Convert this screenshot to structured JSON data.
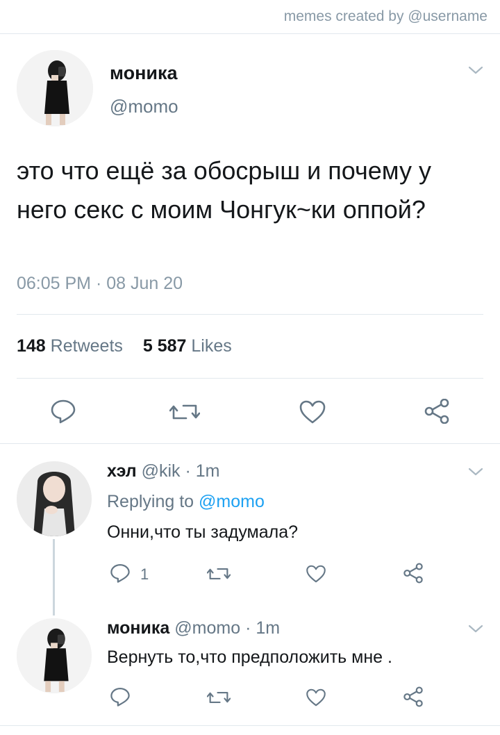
{
  "watermark": "memes created by @username",
  "main_tweet": {
    "name": "моника",
    "handle": "@momo",
    "text": "это что ещё за обосрыш и почему у него секс с моим Чонгук~ки оппой?",
    "timestamp": "06:05 PM · 08 Jun 20",
    "retweets_count": "148",
    "retweets_label": "Retweets",
    "likes_count": "5 587",
    "likes_label": "Likes",
    "icons": [
      "reply-icon",
      "retweet-icon",
      "like-icon",
      "share-icon",
      "chevron-down-icon"
    ]
  },
  "replies": [
    {
      "name": "хэл",
      "handle": "@kik",
      "time": "· 1m",
      "replying_prefix": "Replying to",
      "replying_to": "@momo",
      "text": "Онни,что ты задумала?",
      "reply_count": "1"
    },
    {
      "name": "моника",
      "handle": "@momo",
      "time": "· 1m",
      "text": "Вернуть то,что предположить мне ."
    }
  ],
  "colors": {
    "text": "#14171a",
    "secondary": "#657786",
    "accent": "#1da1f2",
    "divider": "#e1e8ed"
  }
}
